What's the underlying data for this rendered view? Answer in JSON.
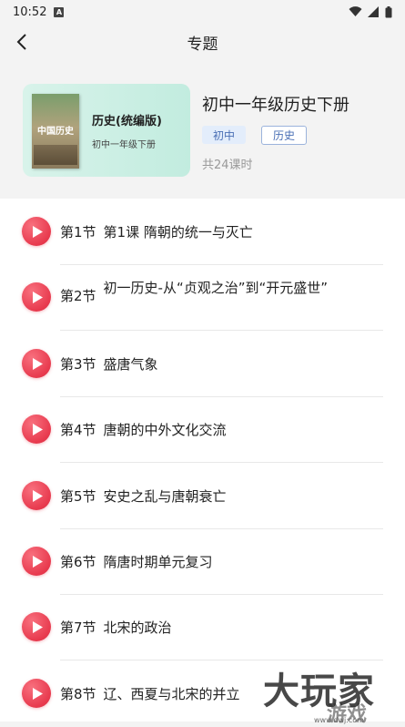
{
  "status": {
    "time": "10:52",
    "a_icon_letter": "A"
  },
  "header": {
    "title": "专题"
  },
  "card": {
    "book_title": "历史(统编版)",
    "book_subtitle": "初中一年级下册",
    "cover_text": "中国历史"
  },
  "info": {
    "title": "初中一年级历史下册",
    "tags": [
      "初中",
      "历史"
    ],
    "count": "共24课时"
  },
  "lessons": [
    {
      "num": "第1节",
      "title": "第1课 隋朝的统一与灭亡"
    },
    {
      "num": "第2节",
      "title": "初一历史-从“贞观之治”到“开元盛世”"
    },
    {
      "num": "第3节",
      "title": "盛唐气象"
    },
    {
      "num": "第4节",
      "title": "唐朝的中外文化交流"
    },
    {
      "num": "第5节",
      "title": "安史之乱与唐朝衰亡"
    },
    {
      "num": "第6节",
      "title": "隋唐时期单元复习"
    },
    {
      "num": "第7节",
      "title": "北宋的政治"
    },
    {
      "num": "第8节",
      "title": "辽、西夏与北宋的并立"
    }
  ],
  "watermark": {
    "main": "大玩家",
    "sub": "游戏",
    "url": "www.dwj.com"
  },
  "colors": {
    "accent": "#e83a4e",
    "tag_blue": "#4a6fb5",
    "card_bg": "#c2ecdf"
  }
}
